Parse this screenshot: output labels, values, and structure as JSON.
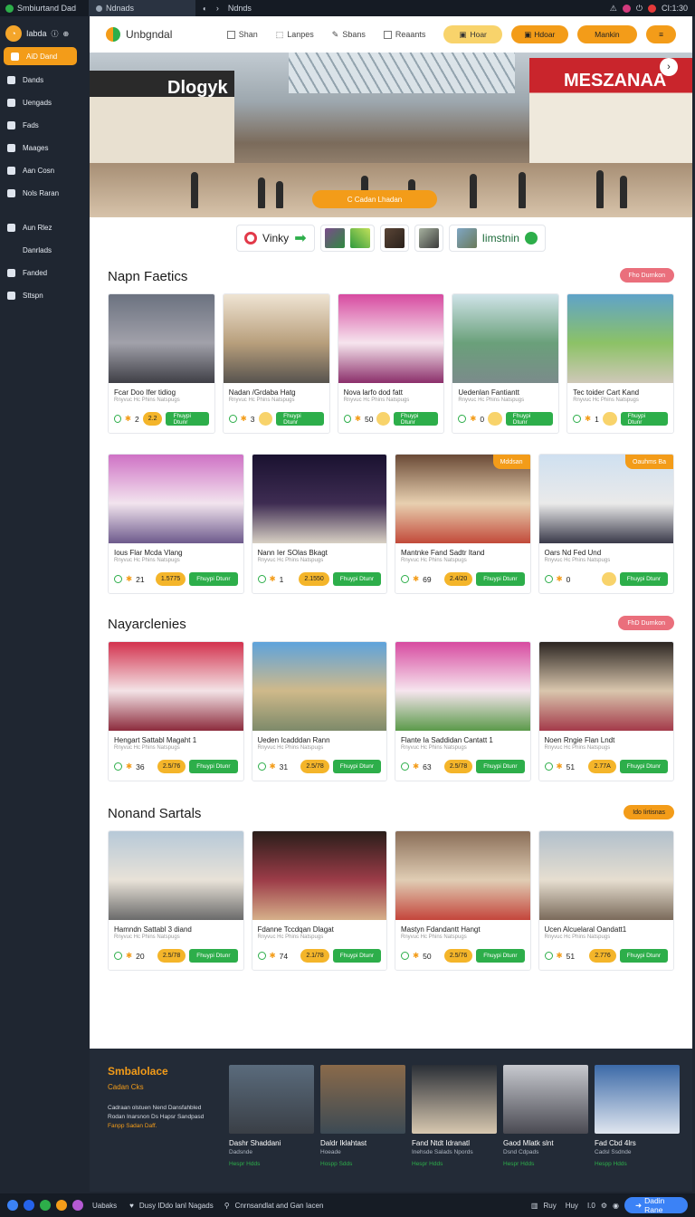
{
  "topbar": {
    "app_title": "Smbiurtand Dad",
    "tab1": "Ndnads",
    "tab2": "Ndnds",
    "right_text": "CI:1:30"
  },
  "sidebar": {
    "profile": "Iabda",
    "items": [
      {
        "label": "AiD Dand",
        "active": true
      },
      {
        "label": "Dands"
      },
      {
        "label": "Uengads"
      },
      {
        "label": "Fads"
      },
      {
        "label": "Maages"
      },
      {
        "label": "Aan Cosn"
      },
      {
        "label": "Nols Raran"
      },
      {
        "label": "Aun Rlez"
      },
      {
        "label": "Danrlads"
      },
      {
        "label": "Fanded"
      },
      {
        "label": "Sttspn"
      }
    ]
  },
  "header": {
    "logo": "Unbgndal",
    "nav": [
      "Shan",
      "Lanpes",
      "Sbans",
      "Reaants"
    ],
    "btn_hoar": "Hoar",
    "btn_hdoar": "Hdoar",
    "btn_mankin": "Mankin"
  },
  "hero": {
    "left_sign": "Dlogyk",
    "right_sign": "MESZANAA",
    "cta": "C Cadan Lhadan"
  },
  "partners": {
    "p1": "Vinky",
    "p2": "Iimstnin"
  },
  "sections": [
    {
      "title": "Napn Faetics",
      "badge": "Fho Durnkon",
      "cards": [
        {
          "title": "Fcar Doo Ifer tidiog",
          "sub": "Rnyvuc Hc Phins Natspugs",
          "count": "2",
          "price": "2.2",
          "btn": "Fhuypi Dtunr"
        },
        {
          "title": "Nadan /Grdaba Hatg",
          "sub": "Rnyvuc Hc Phins Natspugs",
          "count": "3",
          "price": "",
          "btn": "Fhuypi Dtunr"
        },
        {
          "title": "Nova larfo dod fatt",
          "sub": "Rnyvuc Hc Phins Natspugs",
          "count": "50",
          "price": "",
          "btn": "Fhuypi Dtunr"
        },
        {
          "title": "Uedenlan Fantiantt",
          "sub": "Rnyvuc Hc Phins Natspugs",
          "count": "0",
          "price": "",
          "btn": "Fhuypi Dtunr"
        },
        {
          "title": "Tec toider Cart Kand",
          "sub": "Rnyvuc Hc Phins Natspugs",
          "count": "1",
          "price": "",
          "btn": "Fhuypi Dtunr"
        }
      ]
    },
    {
      "title": "",
      "badge": "",
      "cards": [
        {
          "title": "Ious Flar Mcda Vlang",
          "sub": "Rnyvuc Hc Phins Natspugs",
          "count": "21",
          "price": "1.5775",
          "btn": "Fhuypi Dtunr"
        },
        {
          "title": "Nann Ier SOlas Bkagt",
          "sub": "Rnyvuc Hc Phins Natspugs",
          "count": "1",
          "price": "2.1550",
          "btn": "Fhuypi Dtunr"
        },
        {
          "title": "Mantnke Fand Sadtr Itand",
          "sub": "Rnyvuc Hc Phins Natspugs",
          "count": "69",
          "price": "2.4/20",
          "btn": "Fhuypi Dtunr",
          "corner": "Mddsan"
        },
        {
          "title": "Oars Nd Fed Und",
          "sub": "Rnyvuc Hc Phins Natspugs",
          "count": "0",
          "price": "",
          "btn": "Fhuypi Dtunr",
          "corner": "Oauhms Ba"
        }
      ]
    },
    {
      "title": "Nayarclenies",
      "badge": "FhD Durnkon",
      "cards": [
        {
          "title": "Hengart Sattabl Magaht 1",
          "sub": "Rnyvuc Hc Phins Natspugs",
          "count": "36",
          "price": "2.5/76",
          "btn": "Fhuypi Dtunr"
        },
        {
          "title": "Ueden Icadddan Rann",
          "sub": "Rnyvuc Hc Phins Natspugs",
          "count": "31",
          "price": "2.5/78",
          "btn": "Fhuypi Dtunr"
        },
        {
          "title": "Flante Ia Saddidan Cantatt 1",
          "sub": "Rnyvuc Hc Phins Natspugs",
          "count": "63",
          "price": "2.5/78",
          "btn": "Fhuypi Dtunr"
        },
        {
          "title": "Noen Rngie Flan Lndt",
          "sub": "Rnyvuc Hc Phins Natspugs",
          "count": "51",
          "price": "2.77A",
          "btn": "Fhuypi Dtunr"
        }
      ]
    },
    {
      "title": "Nonand Sartals",
      "badge": "Ido Iirtisnas",
      "cards": [
        {
          "title": "Hamndn Sattabl 3 diand",
          "sub": "Rnyvuc Hc Phins Natspugs",
          "count": "20",
          "price": "2.5/78",
          "btn": "Fhuypi Dtunr"
        },
        {
          "title": "Fdanne Tccdqan Dlagat",
          "sub": "Rnyvuc Hc Phins Natspugs",
          "count": "74",
          "price": "2.1/78",
          "btn": "Fhuypi Dtunr"
        },
        {
          "title": "Mastyn Fdandantt Hangt",
          "sub": "Rnyvuc Hc Phins Natspugs",
          "count": "50",
          "price": "2.5/76",
          "btn": "Fhuypi Dtunr"
        },
        {
          "title": "Ucen Alcuelaral Oandatt1",
          "sub": "Rnyvuc Hc Phins Natspugs",
          "count": "51",
          "price": "2.776",
          "btn": "Fhuypi Dtunr"
        }
      ]
    }
  ],
  "footer": {
    "title": "Smbalolace",
    "subtitle": "Cadan Cks",
    "desc1": "Cadraan olstuen Nend Dansfahbled",
    "desc2": "Rodan Inarsnon Ds Hapsr Sandpasd",
    "link": "Fanpp Sadan Daff.",
    "cards": [
      {
        "title": "Dashr Shaddani",
        "sub": "Dadsnde",
        "tag": "Hespr Hdds"
      },
      {
        "title": "Daldr Iklahtast",
        "sub": "Hoeade",
        "tag": "Hospp Sdds"
      },
      {
        "title": "Fand Ntdt Idranatl",
        "sub": "Inehsde Salads Npords",
        "tag": "Hespr Hdds"
      },
      {
        "title": "Gaod Mlatk slnt",
        "sub": "Dsnd Cdpads",
        "tag": "Hespr Hdds"
      },
      {
        "title": "Fad Cbd 4lrs",
        "sub": "Cadsl Ssdnde",
        "tag": "Hespp Hdds"
      }
    ]
  },
  "bottombar": {
    "item1": "Uabaks",
    "item2": "Dusy IDdo lanl Nagads",
    "item3": "Cnrnsandlat and Gan Iacen",
    "r1": "Ruy",
    "r2": "Huy",
    "r3": "I.0",
    "cta": "Dadin Rane"
  },
  "colors": {
    "orange": "#f39c19",
    "green": "#2dae4a",
    "pink": "#ea6f7c",
    "dark": "#1f2631"
  }
}
